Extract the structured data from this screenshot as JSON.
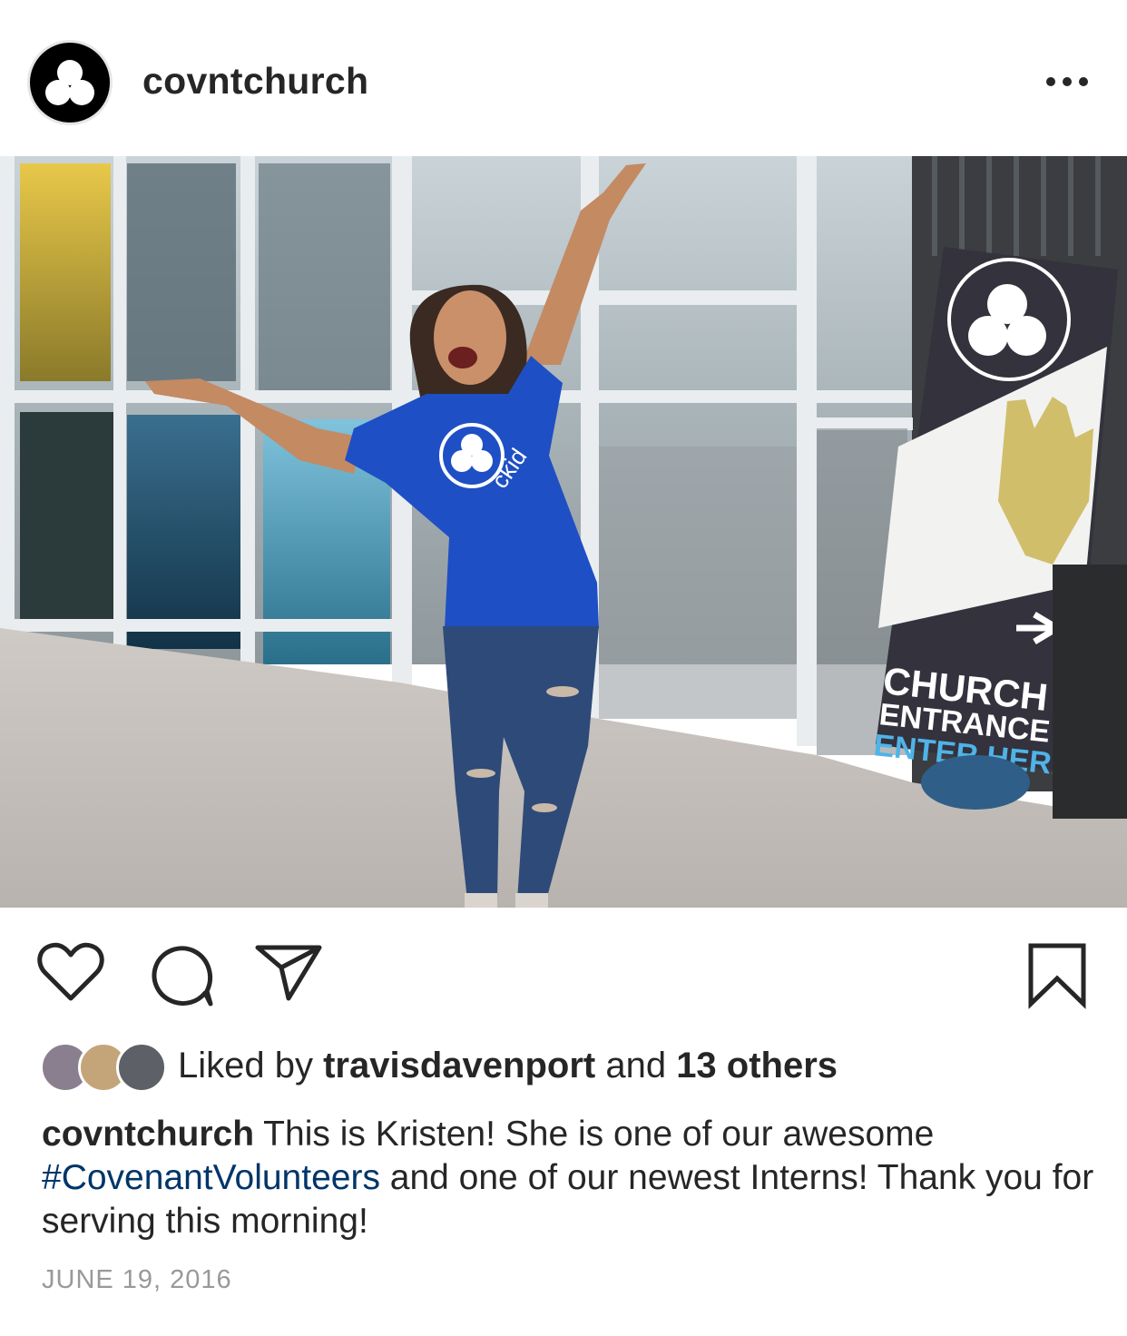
{
  "post": {
    "username": "covntchurch",
    "more_icon": "ellipsis-icon",
    "photo": {
      "description_icon": "post-photo",
      "banner_line1": "CHURCH",
      "banner_line2": "ENTRANCE",
      "banner_line3": "ENTER HERE",
      "shirt_text": "ckid"
    },
    "actions": {
      "like_icon": "heart-icon",
      "comment_icon": "comment-icon",
      "share_icon": "paper-plane-icon",
      "save_icon": "bookmark-icon"
    },
    "likes": {
      "prefix": "Liked by ",
      "user": "travisdavenport",
      "middle": " and ",
      "others": "13 others"
    },
    "caption": {
      "username": "covntchurch",
      "text1": " This is Kristen! She is one of our awesome ",
      "hashtag": "#CovenantVolunteers",
      "text2": " and one of our newest Interns! Thank you for serving this morning!"
    },
    "date": "JUNE 19, 2016"
  },
  "colors": {
    "text": "#262626",
    "hashtag": "#003569",
    "date": "#999999",
    "shirt": "#1e4fc4",
    "banner": "#33323d",
    "banner_link": "#4fb3e8"
  }
}
